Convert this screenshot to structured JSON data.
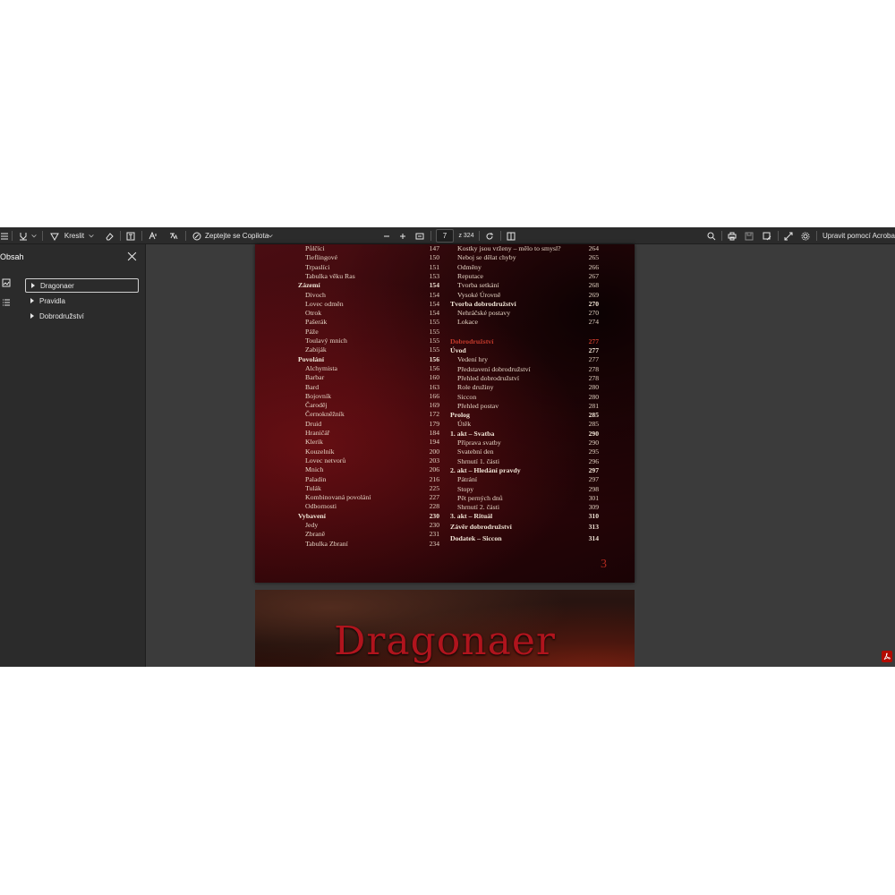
{
  "toolbar": {
    "draw_label": "Kreslit",
    "copilot_label": "Zeptejte se Copilota",
    "page_current": "7",
    "page_total": "z 324",
    "edit_acrobat": "Upravit pomocí Acrobat",
    "icons": [
      "menu-icon",
      "highlight-icon",
      "draw-pen-icon",
      "eraser-icon",
      "text-box-icon",
      "read-aloud-icon",
      "translate-icon",
      "copilot-icon",
      "zoom-out-icon",
      "zoom-in-icon",
      "fit-page-icon",
      "rotate-icon",
      "page-view-icon",
      "search-icon",
      "print-icon",
      "save-icon",
      "save-as-icon",
      "fullscreen-icon",
      "settings-icon"
    ]
  },
  "sidebar": {
    "title": "Obsah",
    "bookmarks": [
      {
        "label": "Dragonaer"
      },
      {
        "label": "Pravidla"
      },
      {
        "label": "Dobrodružství"
      }
    ]
  },
  "document": {
    "left_column": [
      {
        "title": "Půlčíci",
        "page": "147"
      },
      {
        "title": "Tieflingové",
        "page": "150"
      },
      {
        "title": "Trpaslíci",
        "page": "151"
      },
      {
        "title": "Tabulka věku Ras",
        "page": "153"
      },
      {
        "title": "Zázemí",
        "page": "154",
        "bold": true
      },
      {
        "title": "Divoch",
        "page": "154"
      },
      {
        "title": "Lovec odměn",
        "page": "154"
      },
      {
        "title": "Otrok",
        "page": "154"
      },
      {
        "title": "Pašerák",
        "page": "155"
      },
      {
        "title": "Páže",
        "page": "155"
      },
      {
        "title": "Toulavý mnich",
        "page": "155"
      },
      {
        "title": "Zabiják",
        "page": "155"
      },
      {
        "title": "Povolání",
        "page": "156",
        "bold": true
      },
      {
        "title": "Alchymista",
        "page": "156"
      },
      {
        "title": "Barbar",
        "page": "160"
      },
      {
        "title": "Bard",
        "page": "163"
      },
      {
        "title": "Bojovník",
        "page": "166"
      },
      {
        "title": "Čaroděj",
        "page": "169"
      },
      {
        "title": "Černokněžník",
        "page": "172"
      },
      {
        "title": "Druid",
        "page": "179"
      },
      {
        "title": "Hraničář",
        "page": "184"
      },
      {
        "title": "Klerik",
        "page": "194"
      },
      {
        "title": "Kouzelník",
        "page": "200"
      },
      {
        "title": "Lovec netvorů",
        "page": "203"
      },
      {
        "title": "Mnich",
        "page": "206"
      },
      {
        "title": "Paladin",
        "page": "216"
      },
      {
        "title": "Tulák",
        "page": "225"
      },
      {
        "title": "Kombinovaná povolání",
        "page": "227"
      },
      {
        "title": "Odbornosti",
        "page": "228"
      },
      {
        "title": "Vybavení",
        "page": "230",
        "bold": true
      },
      {
        "title": "Jedy",
        "page": "230"
      },
      {
        "title": "Zbraně",
        "page": "231"
      },
      {
        "title": "Tabulka Zbraní",
        "page": "234"
      }
    ],
    "right_column": [
      {
        "title": "Kostky jsou vrženy – mělo to smysl?",
        "page": "264"
      },
      {
        "title": "Neboj se dělat chyby",
        "page": "265"
      },
      {
        "title": "Odměny",
        "page": "266"
      },
      {
        "title": "Reputace",
        "page": "267"
      },
      {
        "title": "Tvorba setkání",
        "page": "268"
      },
      {
        "title": "Vysoké Úrovně",
        "page": "269"
      },
      {
        "title": "Tvorba dobrodružství",
        "page": "270",
        "bold": true
      },
      {
        "title": "Nehráčské postavy",
        "page": "270"
      },
      {
        "title": "Lokace",
        "page": "274"
      },
      {
        "title": "Dobrodružství",
        "page": "277",
        "red": true
      },
      {
        "title": "Úvod",
        "page": "277",
        "bold": true
      },
      {
        "title": "Vedení hry",
        "page": "277"
      },
      {
        "title": "Představení dobrodružství",
        "page": "278"
      },
      {
        "title": "Přehled dobrodružství",
        "page": "278"
      },
      {
        "title": "Role družiny",
        "page": "280"
      },
      {
        "title": "Siccon",
        "page": "280"
      },
      {
        "title": "Přehled postav",
        "page": "281"
      },
      {
        "title": "Prolog",
        "page": "285",
        "bold": true
      },
      {
        "title": "Útěk",
        "page": "285"
      },
      {
        "title": "1. akt – Svatba",
        "page": "290",
        "bold": true
      },
      {
        "title": "Příprava svatby",
        "page": "290"
      },
      {
        "title": "Svatební den",
        "page": "295"
      },
      {
        "title": "Shrnutí 1. části",
        "page": "296"
      },
      {
        "title": "2. akt – Hledání pravdy",
        "page": "297",
        "bold": true
      },
      {
        "title": "Pátrání",
        "page": "297"
      },
      {
        "title": "Stopy",
        "page": "298"
      },
      {
        "title": "Pět perných dnů",
        "page": "301"
      },
      {
        "title": "Shrnutí 2. části",
        "page": "309"
      },
      {
        "title": "3. akt – Rituál",
        "page": "310",
        "bold": true
      },
      {
        "title": "Závěr dobrodružství",
        "page": "313",
        "bold": true
      },
      {
        "title": "Dodatek – Siccon",
        "page": "314",
        "bold": true
      }
    ],
    "page_number": "3",
    "next_page_title": "Dragonaer"
  },
  "colors": {
    "accent_red": "#c43a2b",
    "toolbar_bg": "#2b2b2b",
    "workspace_bg": "#3b3b3b"
  }
}
